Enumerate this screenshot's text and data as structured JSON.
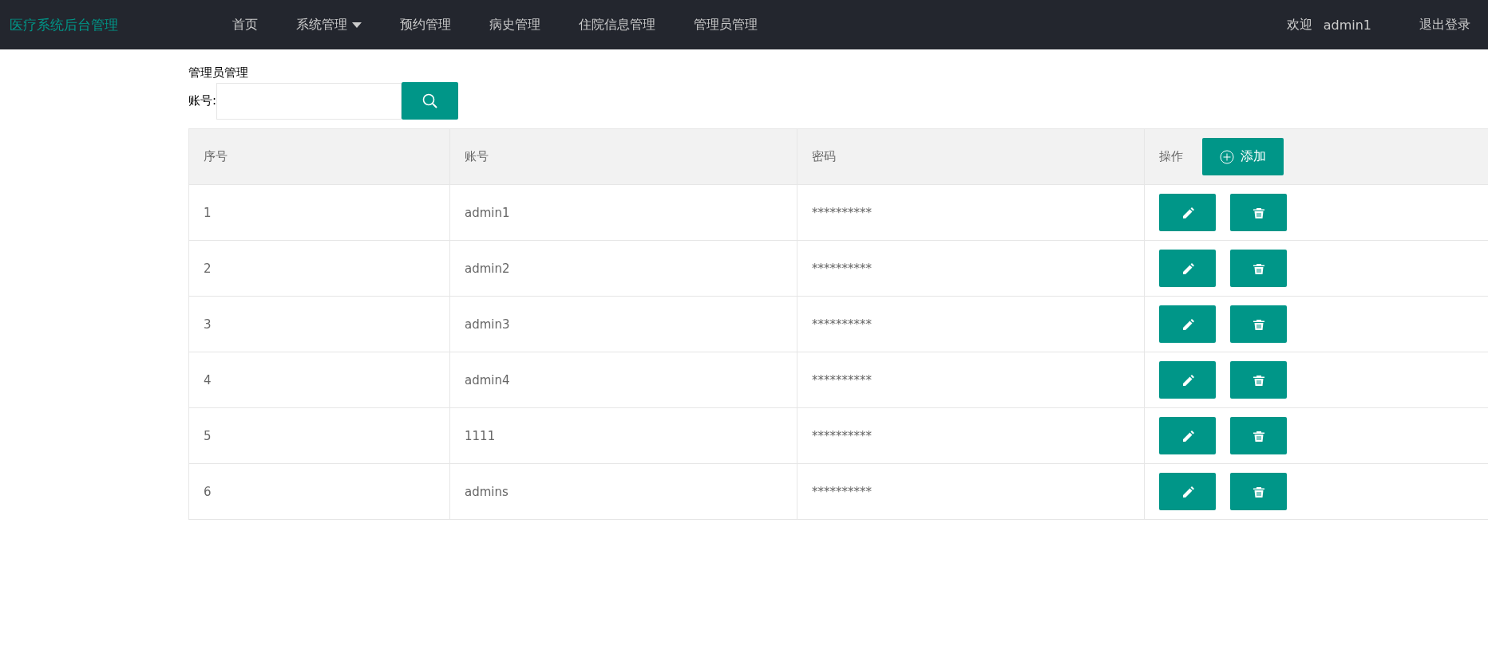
{
  "navbar": {
    "brand": "医疗系统后台管理",
    "items": [
      {
        "label": "首页",
        "dropdown": false
      },
      {
        "label": "系统管理",
        "dropdown": true
      },
      {
        "label": "预约管理",
        "dropdown": false
      },
      {
        "label": "病史管理",
        "dropdown": false
      },
      {
        "label": "住院信息管理",
        "dropdown": false
      },
      {
        "label": "管理员管理",
        "dropdown": false
      }
    ],
    "welcome": "欢迎",
    "user": "admin1",
    "logout": "退出登录"
  },
  "page_title": "管理员管理",
  "search": {
    "label": "账号:"
  },
  "table": {
    "columns": [
      "序号",
      "账号",
      "密码",
      "操作"
    ],
    "add_button": "添加",
    "rows": [
      {
        "index": "1",
        "account": "admin1",
        "password": "**********"
      },
      {
        "index": "2",
        "account": "admin2",
        "password": "**********"
      },
      {
        "index": "3",
        "account": "admin3",
        "password": "**********"
      },
      {
        "index": "4",
        "account": "admin4",
        "password": "**********"
      },
      {
        "index": "5",
        "account": "1111",
        "password": "**********"
      },
      {
        "index": "6",
        "account": "admins",
        "password": "**********"
      }
    ]
  }
}
